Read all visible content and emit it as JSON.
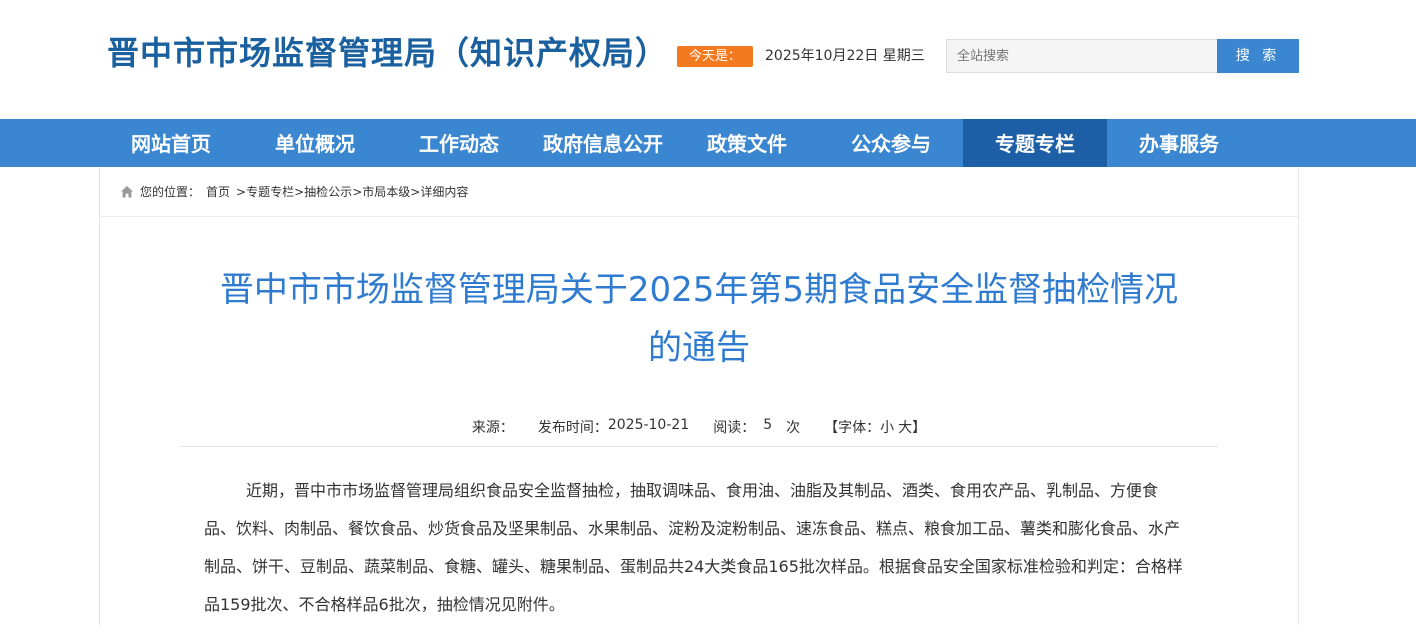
{
  "header": {
    "site_title": "晋中市市场监督管理局（知识产权局）",
    "today_label": "今天是：",
    "date": "2025年10月22日 星期三",
    "search_placeholder": "全站搜索",
    "search_button": "搜 索"
  },
  "nav": {
    "items": [
      {
        "label": "网站首页"
      },
      {
        "label": "单位概况"
      },
      {
        "label": "工作动态"
      },
      {
        "label": "政府信息公开"
      },
      {
        "label": "政策文件"
      },
      {
        "label": "公众参与"
      },
      {
        "label": "专题专栏"
      },
      {
        "label": "办事服务"
      }
    ],
    "active_index": 6
  },
  "breadcrumb": {
    "prefix": "您的位置：",
    "items": [
      "首页",
      "专题专栏",
      "抽检公示",
      "市局本级",
      "详细内容"
    ],
    "separator": ">"
  },
  "article": {
    "title_line1": "晋中市市场监督管理局关于2025年第5期食品安全监督抽检情况",
    "title_line2": "的通告",
    "meta": {
      "source_label": "来源：",
      "source_value": "",
      "publish_label": "发布时间：",
      "publish_date": "2025-10-21",
      "read_label": "阅读：",
      "read_count": "5",
      "read_unit": "次",
      "font_label_open": "【字体：",
      "font_small": "小",
      "font_large": "大",
      "font_label_close": "】"
    },
    "body": "近期，晋中市市场监督管理局组织食品安全监督抽检，抽取调味品、食用油、油脂及其制品、酒类、食用农产品、乳制品、方便食品、饮料、肉制品、餐饮食品、炒货食品及坚果制品、水果制品、淀粉及淀粉制品、速冻食品、糕点、粮食加工品、薯类和膨化食品、水产制品、饼干、豆制品、蔬菜制品、食糖、罐头、糖果制品、蛋制品共24大类食品165批次样品。根据食品安全国家标准检验和判定：合格样品159批次、不合格样品6批次，抽检情况见附件。"
  },
  "colors": {
    "brand_blue": "#3a86d0",
    "nav_active": "#1c5fa6",
    "title_blue": "#2f7bd0",
    "site_title_blue": "#1a5f9e",
    "badge_orange": "#f47a20"
  }
}
